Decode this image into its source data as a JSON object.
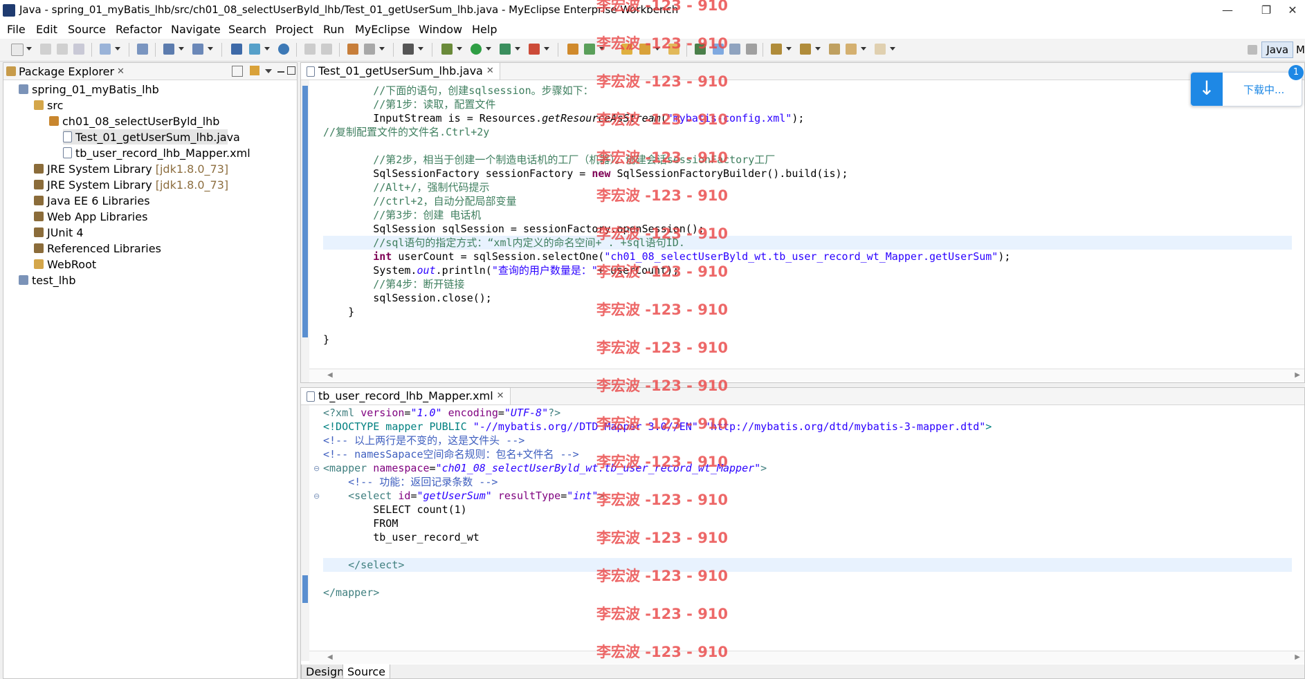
{
  "window": {
    "title": "Java - spring_01_myBatis_lhb/src/ch01_08_selectUserByld_lhb/Test_01_getUserSum_lhb.java - MyEclipse Enterprise Workbench",
    "controls": [
      "—",
      "❐",
      "✕"
    ]
  },
  "menu": [
    "File",
    "Edit",
    "Source",
    "Refactor",
    "Navigate",
    "Search",
    "Project",
    "Run",
    "MyEclipse",
    "Window",
    "Help"
  ],
  "perspective": {
    "java_label": "Java",
    "other_label": "M"
  },
  "package_explorer": {
    "tab_label": "Package Explorer",
    "tree": [
      {
        "label": "spring_01_myBatis_lhb",
        "extra": ""
      },
      {
        "label": "src",
        "extra": ""
      },
      {
        "label": "ch01_08_selectUserByld_lhb",
        "extra": ""
      },
      {
        "label": "Test_01_getUserSum_lhb.java",
        "extra": ""
      },
      {
        "label": "tb_user_record_lhb_Mapper.xml",
        "extra": ""
      },
      {
        "label": "JRE System Library",
        "extra": "[jdk1.8.0_73]"
      },
      {
        "label": "JRE System Library",
        "extra": "[jdk1.8.0_73]"
      },
      {
        "label": "Java EE 6 Libraries",
        "extra": ""
      },
      {
        "label": "Web App Libraries",
        "extra": ""
      },
      {
        "label": "JUnit 4",
        "extra": ""
      },
      {
        "label": "Referenced Libraries",
        "extra": ""
      },
      {
        "label": "WebRoot",
        "extra": ""
      },
      {
        "label": "test_lhb",
        "extra": ""
      }
    ]
  },
  "java_editor": {
    "tab_label": "Test_01_getUserSum_lhb.java",
    "lines": [
      {
        "segments": [
          {
            "c": "cm",
            "t": "        //下面的语句，创建sqlsession。步骤如下："
          }
        ]
      },
      {
        "segments": [
          {
            "c": "cm",
            "t": "        //第1步：读取，配置文件"
          }
        ]
      },
      {
        "segments": [
          {
            "c": "",
            "t": "        InputStream is = Resources."
          },
          {
            "c": "it",
            "t": "getResourceAsStream"
          },
          {
            "c": "",
            "t": "("
          },
          {
            "c": "str",
            "t": "\"mybatis-config.xml\""
          },
          {
            "c": "",
            "t": ");"
          }
        ]
      },
      {
        "segments": [
          {
            "c": "cm",
            "t": "//复制配置文件的文件名.Ctrl+2y"
          }
        ]
      },
      {
        "segments": [
          {
            "c": "",
            "t": ""
          }
        ]
      },
      {
        "segments": [
          {
            "c": "cm",
            "t": "        //第2步，相当于创建一个制造电话机的工厂（机器）。创建会话sessionFactory工厂"
          }
        ]
      },
      {
        "segments": [
          {
            "c": "",
            "t": "        SqlSessionFactory sessionFactory = "
          },
          {
            "c": "kw",
            "t": "new"
          },
          {
            "c": "",
            "t": " SqlSessionFactoryBuilder().build(is);"
          }
        ]
      },
      {
        "segments": [
          {
            "c": "cm",
            "t": "        //Alt+/，强制代码提示"
          }
        ]
      },
      {
        "segments": [
          {
            "c": "cm",
            "t": "        //ctrl+2，自动分配局部变量"
          }
        ]
      },
      {
        "segments": [
          {
            "c": "cm",
            "t": "        //第3步：创建 电话机"
          }
        ]
      },
      {
        "segments": [
          {
            "c": "",
            "t": "        SqlSession sqlSession = sessionFactory.openSession();"
          }
        ]
      },
      {
        "segments": [
          {
            "c": "cm",
            "t": "        //sql语句的指定方式：“xml内定义的命名空间+ . +sql语句ID."
          }
        ]
      },
      {
        "segments": [
          {
            "c": "",
            "t": "        "
          },
          {
            "c": "kw",
            "t": "int"
          },
          {
            "c": "",
            "t": " userCount = sqlSession.selectOne("
          },
          {
            "c": "str",
            "t": "\"ch01_08_selectUserByld_wt.tb_user_record_wt_Mapper.getUserSum\""
          },
          {
            "c": "",
            "t": ");"
          }
        ]
      },
      {
        "segments": [
          {
            "c": "",
            "t": "        System."
          },
          {
            "c": "str it",
            "t": "out"
          },
          {
            "c": "",
            "t": ".println("
          },
          {
            "c": "str",
            "t": "\"查询的用户数量是：\""
          },
          {
            "c": "",
            "t": "+ userCount);"
          }
        ]
      },
      {
        "segments": [
          {
            "c": "cm",
            "t": "        //第4步：断开链接"
          }
        ]
      },
      {
        "segments": [
          {
            "c": "",
            "t": "        sqlSession.close();"
          }
        ]
      },
      {
        "segments": [
          {
            "c": "",
            "t": "    }"
          }
        ]
      },
      {
        "segments": [
          {
            "c": "",
            "t": ""
          }
        ]
      },
      {
        "segments": [
          {
            "c": "",
            "t": "}"
          }
        ]
      }
    ]
  },
  "xml_editor": {
    "tab_label": "tb_user_record_lhb_Mapper.xml",
    "lines": [
      {
        "segments": [
          {
            "c": "tag",
            "t": "<?xml "
          },
          {
            "c": "att",
            "t": "version"
          },
          {
            "c": "",
            "t": "="
          },
          {
            "c": "aval",
            "t": "\"1.0\""
          },
          {
            "c": "",
            "t": " "
          },
          {
            "c": "att",
            "t": "encoding"
          },
          {
            "c": "",
            "t": "="
          },
          {
            "c": "aval",
            "t": "\"UTF-8\""
          },
          {
            "c": "tag",
            "t": "?>"
          }
        ]
      },
      {
        "segments": [
          {
            "c": "dt",
            "t": "<!DOCTYPE mapper PUBLIC "
          },
          {
            "c": "str",
            "t": "\"-//mybatis.org//DTD Mapper 3.0//EN\""
          },
          {
            "c": "dt",
            "t": " "
          },
          {
            "c": "str",
            "t": "\"http://mybatis.org/dtd/mybatis-3-mapper.dtd\""
          },
          {
            "c": "dt",
            "t": ">"
          }
        ]
      },
      {
        "segments": [
          {
            "c": "xcm",
            "t": "<!-- 以上两行是不变的，这是文件头 -->"
          }
        ]
      },
      {
        "segments": [
          {
            "c": "xcm",
            "t": "<!-- namesSapace空间命名规则：包名+文件名 -->"
          }
        ]
      },
      {
        "segments": [
          {
            "c": "tag",
            "t": "<mapper "
          },
          {
            "c": "att",
            "t": "namespace"
          },
          {
            "c": "",
            "t": "="
          },
          {
            "c": "aval",
            "t": "\"ch01_08_selectUserByld_wt.tb_user_record_wt_Mapper\""
          },
          {
            "c": "tag",
            "t": ">"
          }
        ]
      },
      {
        "segments": [
          {
            "c": "xcm",
            "t": "    <!-- 功能：返回记录条数 -->"
          }
        ]
      },
      {
        "segments": [
          {
            "c": "tag",
            "t": "    <select "
          },
          {
            "c": "att",
            "t": "id"
          },
          {
            "c": "",
            "t": "="
          },
          {
            "c": "aval",
            "t": "\"getUserSum\""
          },
          {
            "c": "",
            "t": " "
          },
          {
            "c": "att",
            "t": "resultType"
          },
          {
            "c": "",
            "t": "="
          },
          {
            "c": "aval",
            "t": "\"int\""
          },
          {
            "c": "tag",
            "t": ">"
          }
        ]
      },
      {
        "segments": [
          {
            "c": "",
            "t": "        SELECT count(1)"
          }
        ]
      },
      {
        "segments": [
          {
            "c": "",
            "t": "        FROM"
          }
        ]
      },
      {
        "segments": [
          {
            "c": "",
            "t": "        tb_user_record_wt"
          }
        ]
      },
      {
        "segments": [
          {
            "c": "",
            "t": ""
          }
        ]
      },
      {
        "segments": [
          {
            "c": "tag",
            "t": "    </select>"
          }
        ]
      },
      {
        "segments": [
          {
            "c": "",
            "t": ""
          }
        ]
      },
      {
        "segments": [
          {
            "c": "tag",
            "t": "</mapper>"
          }
        ]
      }
    ],
    "bottom_tabs": [
      "Design",
      "Source"
    ]
  },
  "watermark": {
    "text": "李宏波 -123 - 910"
  },
  "download_popup": {
    "label": "下载中...",
    "badge": "1"
  },
  "colors": {
    "accent": "#1e88e5",
    "watermark": "#ea4848",
    "selection": "#e5e5e5"
  }
}
